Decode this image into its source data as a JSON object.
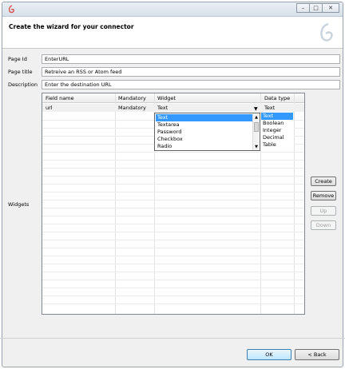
{
  "header": {
    "title": "Create the wizard for your connector"
  },
  "form": {
    "page_id_label": "Page Id",
    "page_id_value": "EnterURL",
    "page_title_label": "Page title",
    "page_title_value": "Retreive an RSS or Atom feed",
    "description_label": "Description",
    "description_value": "Enter the destination URL",
    "widgets_label": "Widgets"
  },
  "table": {
    "columns": [
      "Field name",
      "Mandatory",
      "Widget",
      "Data type"
    ],
    "rows": [
      {
        "field_name": "url",
        "mandatory": "Mandatory",
        "widget": "Text",
        "data_type": "Text"
      }
    ]
  },
  "widget_dropdown": {
    "selected": "Text",
    "options": [
      "Text",
      "Textarea",
      "Password",
      "Checkbox",
      "Radio"
    ]
  },
  "datatype_list": {
    "selected": "Text",
    "options": [
      "Text",
      "Boolean",
      "Integer",
      "Decimal",
      "Table"
    ]
  },
  "side_buttons": {
    "create": "Create",
    "remove": "Remove",
    "up": "Up",
    "down": "Down"
  },
  "footer": {
    "ok": "OK",
    "back": "< Back"
  },
  "colors": {
    "selection": "#3399ff",
    "header_bg": "#ffffff",
    "dialog_bg": "#f0f0f0"
  }
}
